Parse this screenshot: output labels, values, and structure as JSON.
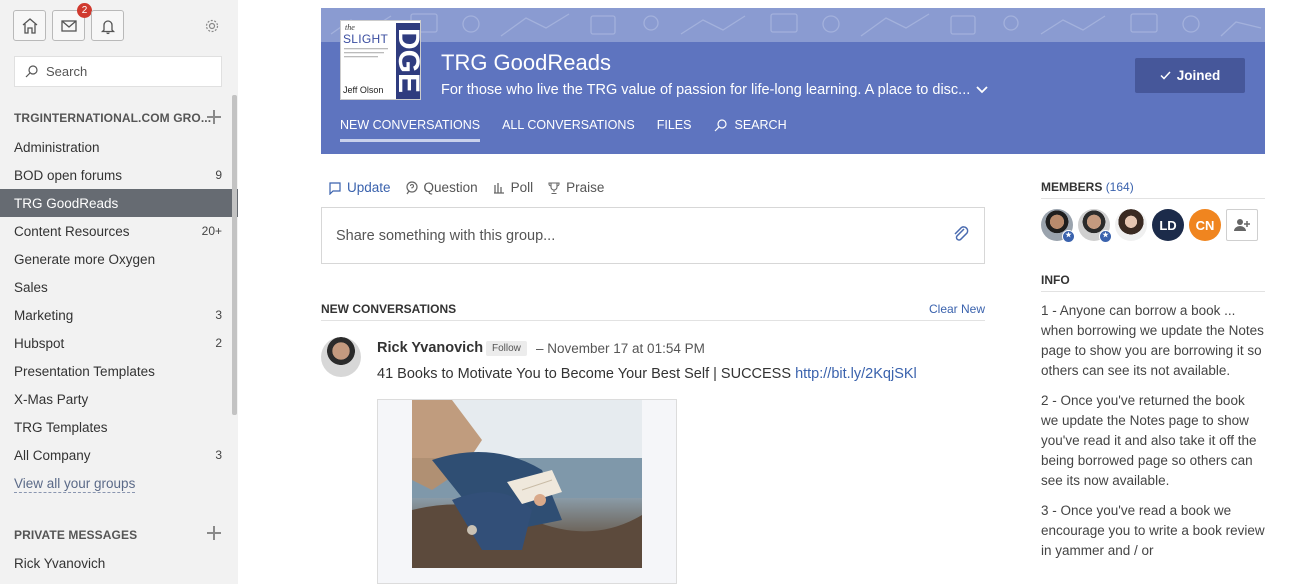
{
  "sidebar": {
    "mail_badge": "2",
    "search_placeholder": "Search",
    "groups_header": "TRGINTERNATIONAL.COM GRO...",
    "groups": [
      {
        "label": "Administration",
        "count": ""
      },
      {
        "label": "BOD open forums",
        "count": "9"
      },
      {
        "label": "TRG GoodReads",
        "count": ""
      },
      {
        "label": "Content Resources",
        "count": "20+"
      },
      {
        "label": "Generate more Oxygen",
        "count": ""
      },
      {
        "label": "Sales",
        "count": ""
      },
      {
        "label": "Marketing",
        "count": "3"
      },
      {
        "label": "Hubspot",
        "count": "2"
      },
      {
        "label": "Presentation Templates",
        "count": ""
      },
      {
        "label": "X-Mas Party",
        "count": ""
      },
      {
        "label": "TRG Templates",
        "count": ""
      },
      {
        "label": "All Company",
        "count": "3"
      }
    ],
    "view_all": "View all your groups",
    "pm_header": "PRIVATE MESSAGES",
    "pm_items": [
      "Rick Yvanovich"
    ]
  },
  "group": {
    "cover": {
      "the": "the",
      "slight": "SLIGHT",
      "edge": "DGE",
      "author": "Jeff Olson"
    },
    "title": "TRG GoodReads",
    "description": "For those who live the TRG value of passion for life-long learning. A place to disc...",
    "joined_label": "Joined",
    "tabs": [
      "NEW CONVERSATIONS",
      "ALL CONVERSATIONS",
      "FILES",
      "SEARCH"
    ],
    "colors": {
      "banner": "#5e74bf",
      "accent": "#3a62ad"
    }
  },
  "composer": {
    "tabs": [
      "Update",
      "Question",
      "Poll",
      "Praise"
    ],
    "placeholder": "Share something with this group..."
  },
  "feed": {
    "header": "NEW CONVERSATIONS",
    "clear_new": "Clear New",
    "post": {
      "author": "Rick Yvanovich",
      "follow": "Follow",
      "time": "– November 17 at 01:54 PM",
      "text": "41 Books to Motivate You to Become Your Best Self | SUCCESS",
      "link": "http://bit.ly/2KqjSKl"
    }
  },
  "members": {
    "label": "MEMBERS",
    "count": "(164)",
    "initials": [
      "LD",
      "CN"
    ]
  },
  "info": {
    "label": "INFO",
    "items": [
      "1 - Anyone can borrow a book ... when borrowing we update the Notes page to show you are borrowing it so others can see its not available.",
      "2 - Once you've returned the book we update the Notes page to show you've read it and also take it off the being borrowed page so others can see its now available.",
      "3 - Once you've read a book we encourage you to write a book review in yammer and / or"
    ]
  }
}
